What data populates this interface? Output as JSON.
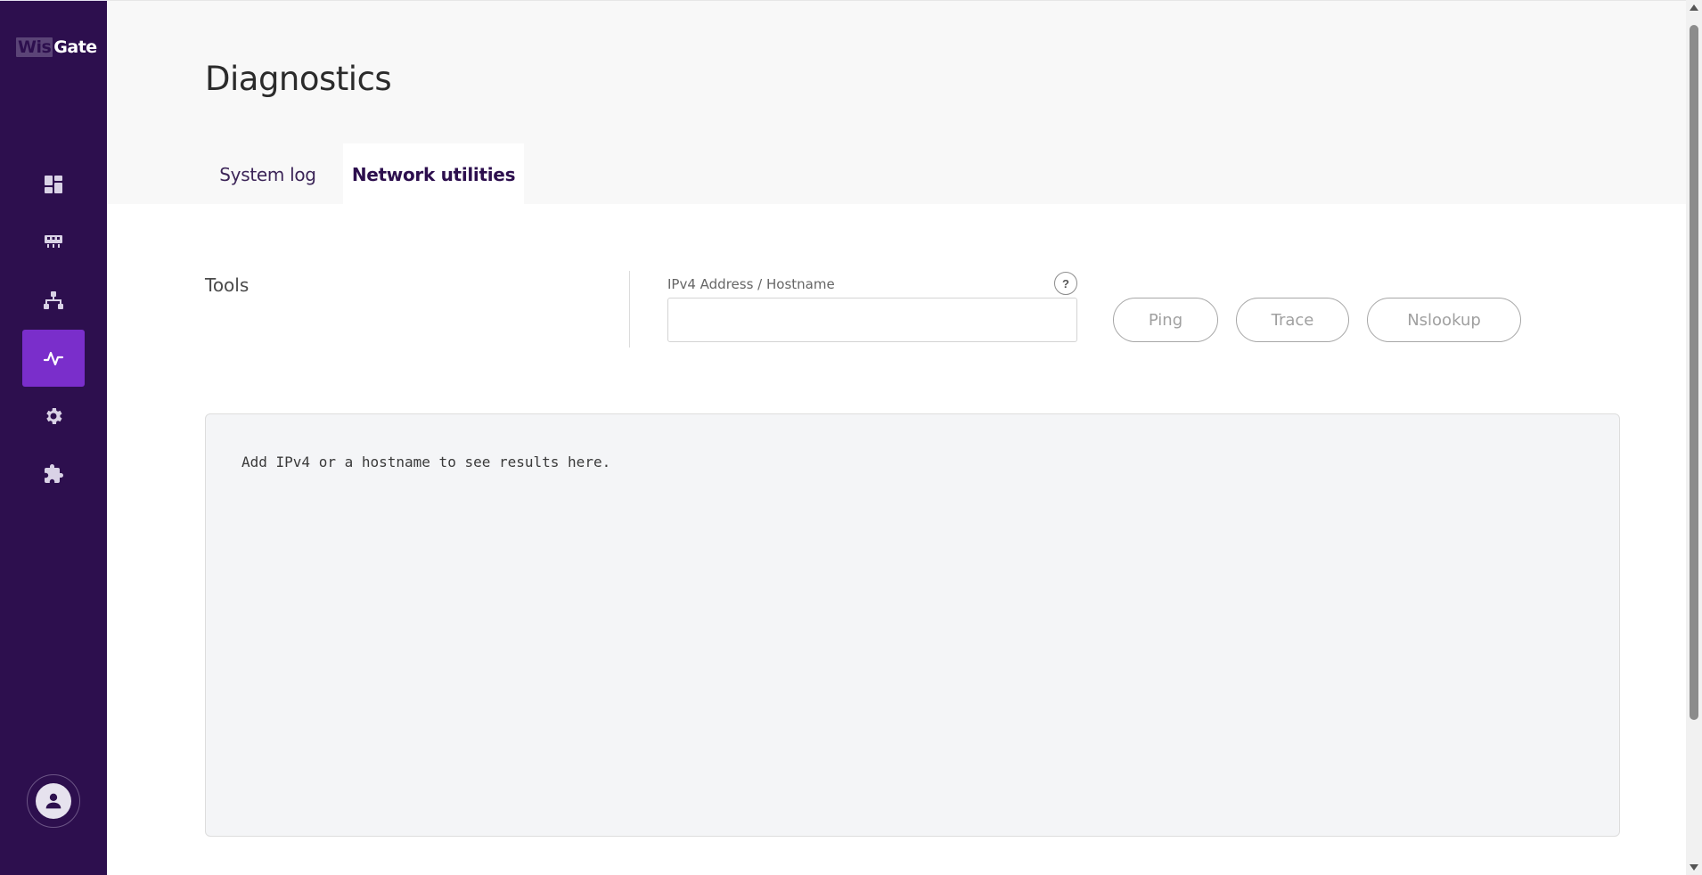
{
  "logo": {
    "part1": "Wis",
    "part2": "Gate"
  },
  "sidebar": {
    "items": [
      {
        "icon": "dashboard-icon",
        "active": false
      },
      {
        "icon": "gateway-icon",
        "active": false
      },
      {
        "icon": "network-icon",
        "active": false
      },
      {
        "icon": "activity-icon",
        "active": true
      },
      {
        "icon": "gear-icon",
        "active": false
      },
      {
        "icon": "puzzle-icon",
        "active": false
      }
    ],
    "user_icon": "user-icon"
  },
  "header": {
    "title": "Diagnostics",
    "tabs": [
      {
        "label": "System log",
        "active": false
      },
      {
        "label": "Network utilities",
        "active": true
      }
    ]
  },
  "tools": {
    "section_label": "Tools",
    "field_label": "IPv4 Address / Hostname",
    "help_glyph": "?",
    "input_value": "",
    "input_placeholder": "",
    "buttons": {
      "ping": "Ping",
      "trace": "Trace",
      "nslookup": "Nslookup"
    }
  },
  "results": {
    "text": "Add IPv4 or a hostname to see results here."
  },
  "colors": {
    "sidebar": "#2d0f4e",
    "accent": "#7a2ecb",
    "header_bg": "#f8f8f8",
    "results_bg": "#f4f5f7"
  }
}
